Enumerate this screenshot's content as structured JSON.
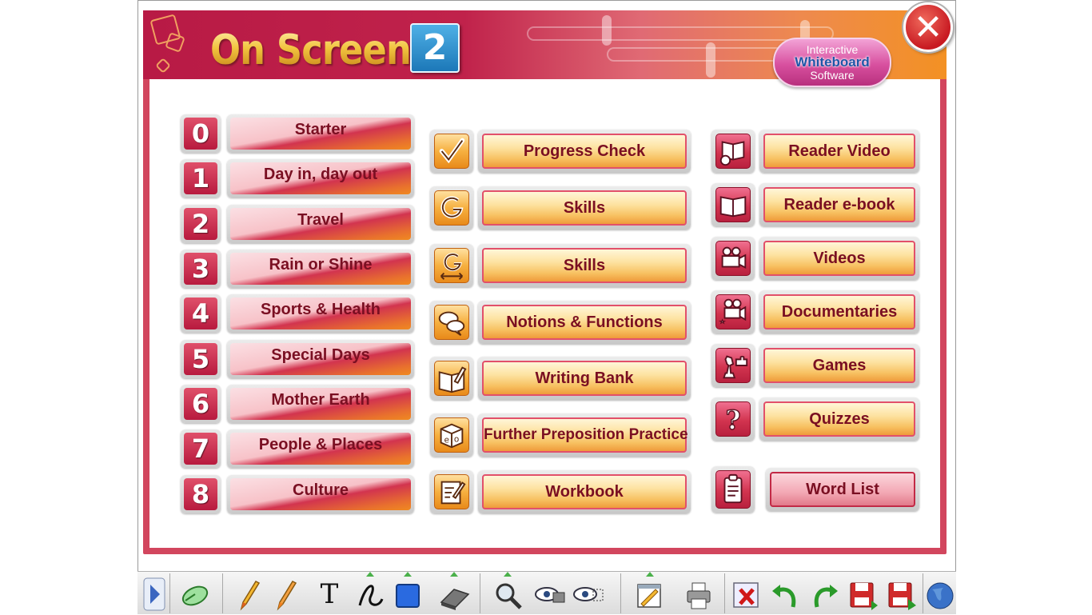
{
  "header": {
    "logo_text": "On Screen",
    "logo_level": "2",
    "badge": {
      "line1": "Interactive",
      "line2": "Whiteboard",
      "line3": "Software"
    }
  },
  "units": [
    {
      "number": "0",
      "label": "Starter"
    },
    {
      "number": "1",
      "label": "Day in, day out"
    },
    {
      "number": "2",
      "label": "Travel"
    },
    {
      "number": "3",
      "label": "Rain or Shine"
    },
    {
      "number": "4",
      "label": "Sports & Health"
    },
    {
      "number": "5",
      "label": "Special Days"
    },
    {
      "number": "6",
      "label": "Mother Earth"
    },
    {
      "number": "7",
      "label": "People & Places"
    },
    {
      "number": "8",
      "label": "Culture"
    }
  ],
  "middle": [
    {
      "label": "Progress Check",
      "icon": "checkmark-icon"
    },
    {
      "label": "Skills",
      "icon": "skills-icon"
    },
    {
      "label": "Skills",
      "icon": "skills-arrows-icon"
    },
    {
      "label": "Notions & Functions",
      "icon": "speech-bubbles-icon"
    },
    {
      "label": "Writing Bank",
      "icon": "writing-book-icon"
    },
    {
      "label": "Further Preposition Practice",
      "icon": "dice-icon"
    },
    {
      "label": "Workbook",
      "icon": "workbook-icon"
    }
  ],
  "right": [
    {
      "label": "Reader Video",
      "icon": "reader-video-icon"
    },
    {
      "label": "Reader e-book",
      "icon": "open-book-icon"
    },
    {
      "label": "Videos",
      "icon": "video-camera-icon"
    },
    {
      "label": "Documentaries",
      "icon": "documentary-camera-icon"
    },
    {
      "label": "Games",
      "icon": "chess-puzzle-icon"
    },
    {
      "label": "Quizzes",
      "icon": "question-icon"
    },
    {
      "label": "Word List",
      "icon": "clipboard-icon"
    }
  ],
  "colors": {
    "header_red": "#c0224b",
    "header_orange": "#f39123",
    "frame": "#d2465e",
    "unit_text": "#7a0f22",
    "level_blue": "#1c78b8"
  },
  "toolbar": {
    "text_tool_glyph": "T"
  }
}
